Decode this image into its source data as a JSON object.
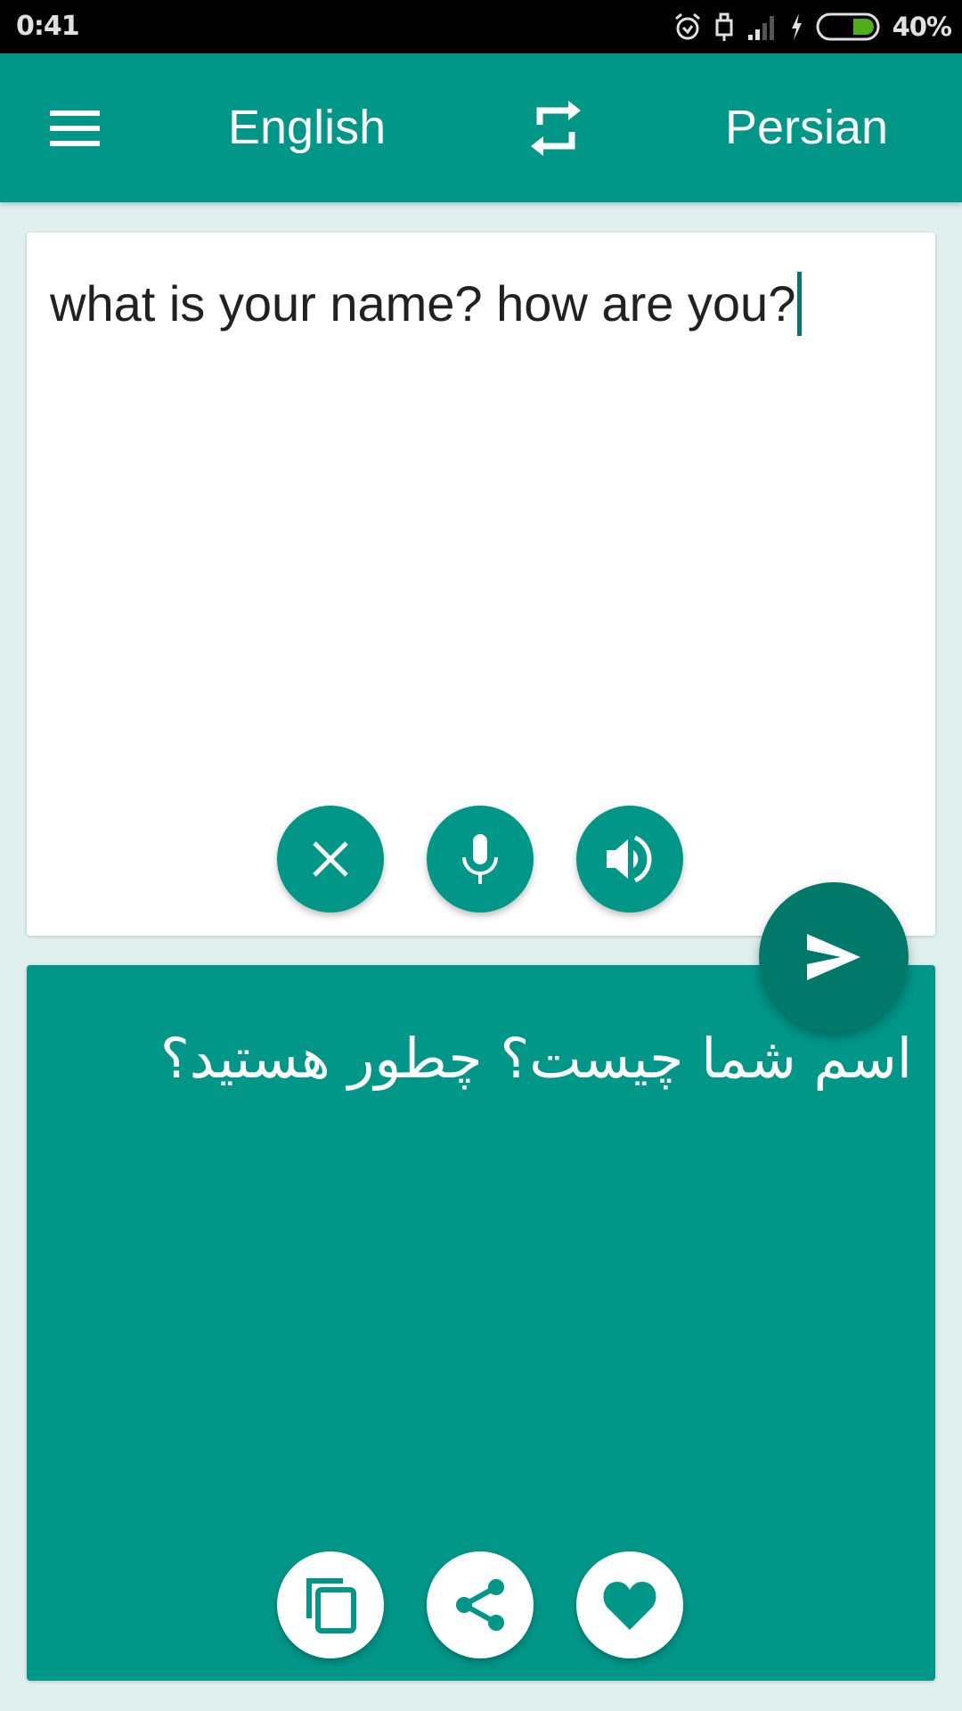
{
  "status_bar": {
    "time": "0:41",
    "battery_percent": "40%",
    "icons": [
      "alarm-icon",
      "usb-icon",
      "signal-icon",
      "charging-icon",
      "battery-icon"
    ]
  },
  "app_bar": {
    "menu_icon": "menu-icon",
    "source_language": "English",
    "swap_icon": "swap-icon",
    "target_language": "Persian"
  },
  "input": {
    "text": "what is your name? how are you?",
    "actions": [
      {
        "name": "clear",
        "icon": "close-icon"
      },
      {
        "name": "voice-input",
        "icon": "microphone-icon"
      },
      {
        "name": "speak",
        "icon": "speaker-icon"
      }
    ]
  },
  "translate_button": {
    "icon": "send-icon"
  },
  "output": {
    "text": "اسم شما چیست؟ چطور هستید؟",
    "actions": [
      {
        "name": "copy",
        "icon": "copy-icon"
      },
      {
        "name": "share",
        "icon": "share-icon"
      },
      {
        "name": "favorite",
        "icon": "heart-icon"
      }
    ]
  },
  "colors": {
    "primary": "#009688",
    "primary_dark": "#00796b",
    "background": "#dff0ee"
  }
}
